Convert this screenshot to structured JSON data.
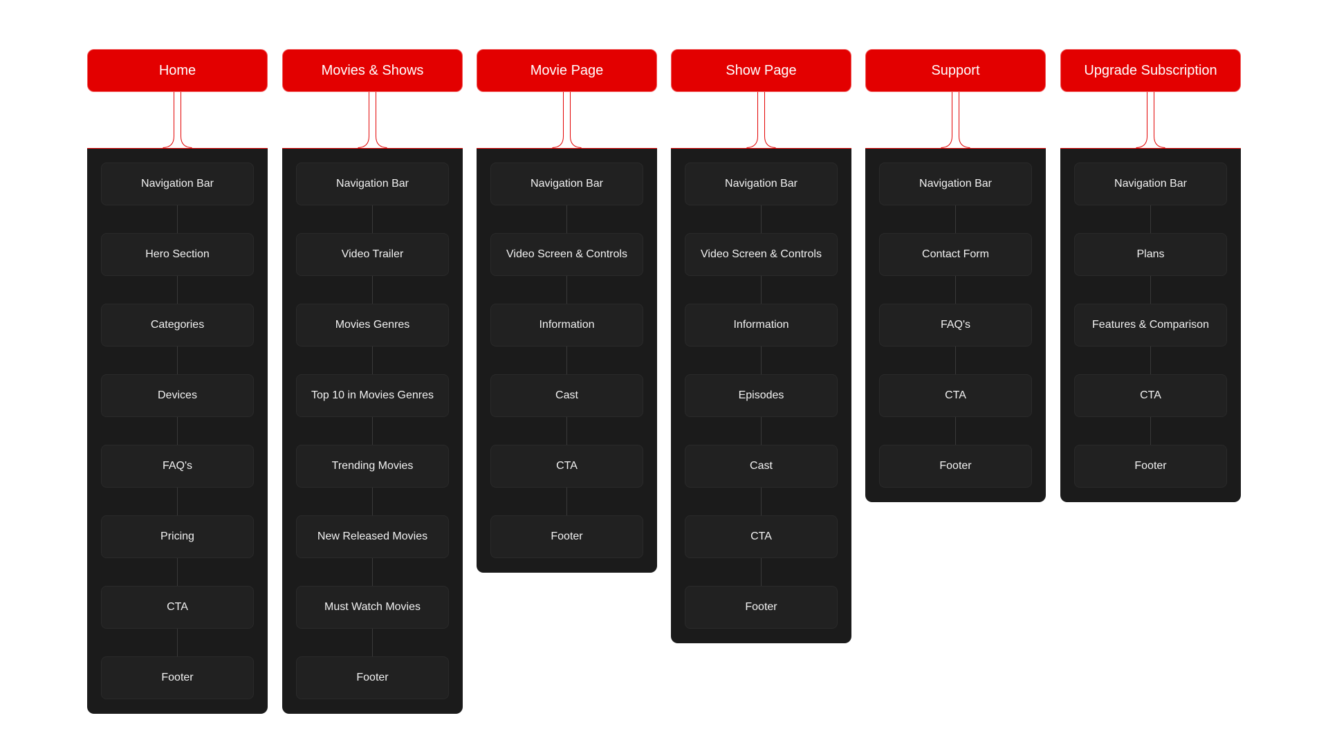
{
  "colors": {
    "header": "#e30000",
    "panel": "#1b1b1b",
    "card": "#212121",
    "text": "#ffffff"
  },
  "columns": [
    {
      "title": "Home",
      "items": [
        "Navigation Bar",
        "Hero Section",
        "Categories",
        "Devices",
        "FAQ's",
        "Pricing",
        "CTA",
        "Footer"
      ]
    },
    {
      "title": "Movies & Shows",
      "items": [
        "Navigation Bar",
        "Video Trailer",
        "Movies Genres",
        "Top 10 in Movies Genres",
        "Trending Movies",
        "New Released Movies",
        "Must Watch Movies",
        "Footer"
      ]
    },
    {
      "title": "Movie Page",
      "items": [
        "Navigation Bar",
        "Video Screen & Controls",
        "Information",
        "Cast",
        "CTA",
        "Footer"
      ]
    },
    {
      "title": "Show Page",
      "items": [
        "Navigation Bar",
        "Video Screen & Controls",
        "Information",
        "Episodes",
        "Cast",
        "CTA",
        "Footer"
      ]
    },
    {
      "title": "Support",
      "items": [
        "Navigation Bar",
        "Contact Form",
        "FAQ's",
        "CTA",
        "Footer"
      ]
    },
    {
      "title": "Upgrade Subscription",
      "items": [
        "Navigation Bar",
        "Plans",
        "Features & Comparison",
        "CTA",
        "Footer"
      ]
    }
  ]
}
